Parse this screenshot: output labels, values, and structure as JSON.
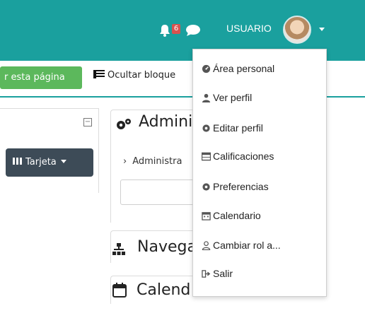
{
  "navbar": {
    "notification_count": "6",
    "user_label": "USUARIO"
  },
  "toolbar": {
    "edit_button": "r esta página",
    "hide_blocks": "Ocultar bloque"
  },
  "left_panel": {
    "collapse_symbol": "−",
    "view_button": "Tarjeta"
  },
  "blocks": {
    "admin_title": "Admini",
    "admin_link": "Administra",
    "nav_title": "Navega",
    "calendar_title": "Calend"
  },
  "user_menu": {
    "items": [
      {
        "label": "Área personal",
        "icon": "dashboard-icon"
      },
      {
        "label": "Ver perfil",
        "icon": "user-icon"
      },
      {
        "label": "Editar perfil",
        "icon": "cog-icon"
      },
      {
        "label": "Calificaciones",
        "icon": "table-icon"
      },
      {
        "label": "Preferencias",
        "icon": "cog-icon"
      },
      {
        "label": "Calendario",
        "icon": "calendar-icon"
      },
      {
        "label": "Cambiar rol a...",
        "icon": "user-outline-icon"
      },
      {
        "label": "Salir",
        "icon": "sign-out-icon"
      }
    ]
  },
  "colors": {
    "navbar": "#1aa09e",
    "edit_button": "#5cb85c",
    "tarjeta_button": "#3d4b57",
    "badge": "#d9534f"
  }
}
